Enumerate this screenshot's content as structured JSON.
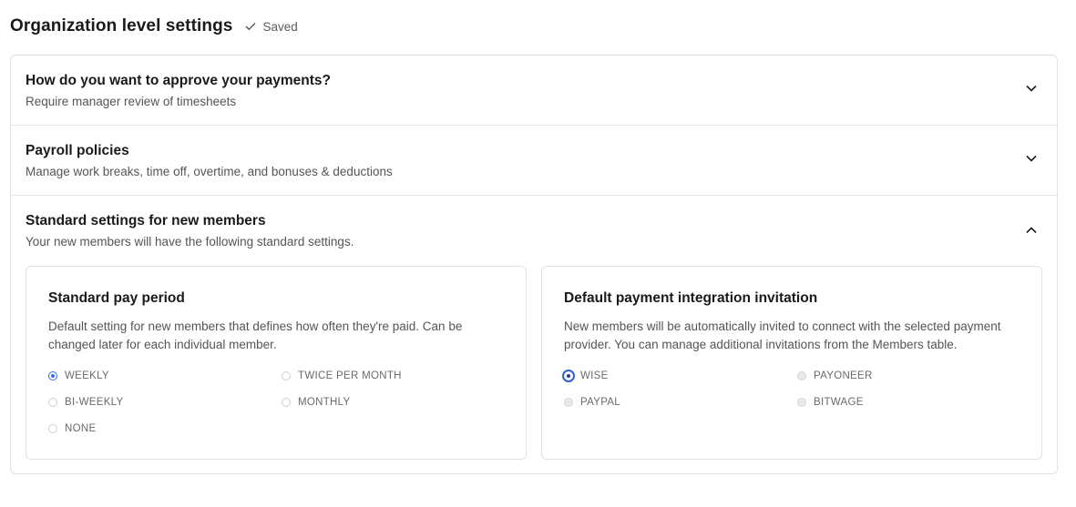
{
  "header": {
    "title": "Organization level settings",
    "saved_label": "Saved"
  },
  "sections": [
    {
      "title": "How do you want to approve your payments?",
      "subtitle": "Require manager review of timesheets",
      "expanded": false
    },
    {
      "title": "Payroll policies",
      "subtitle": "Manage work breaks, time off, overtime, and bonuses & deductions",
      "expanded": false
    },
    {
      "title": "Standard settings for new members",
      "subtitle": "Your new members will have the following standard settings.",
      "expanded": true
    }
  ],
  "pay_period": {
    "title": "Standard pay period",
    "description": "Default setting for new members that defines how often they're paid. Can be changed later for each individual member.",
    "options": [
      "WEEKLY",
      "TWICE PER MONTH",
      "BI-WEEKLY",
      "MONTHLY",
      "NONE"
    ],
    "selected": "WEEKLY"
  },
  "payment_integration": {
    "title": "Default payment integration invitation",
    "description": "New members will be automatically invited to connect with the selected payment provider. You can manage additional invitations from the Members table.",
    "options": [
      "WISE",
      "PAYONEER",
      "PAYPAL",
      "BITWAGE"
    ],
    "selected": "WISE"
  },
  "colors": {
    "accent": "#2f6fe4"
  },
  "icons": {
    "saved": "check-icon",
    "collapsed": "chevron-down-icon",
    "expanded": "chevron-up-icon"
  }
}
